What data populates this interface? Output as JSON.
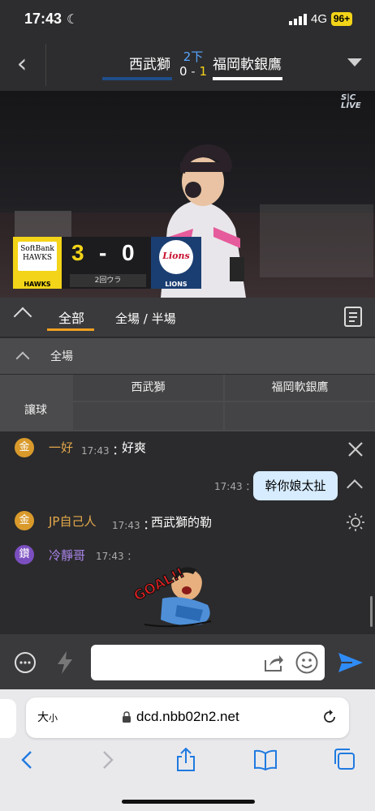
{
  "status_bar": {
    "time": "17:43",
    "network": "4G",
    "battery": "96+"
  },
  "header": {
    "home_team": "西武獅",
    "away_team": "福岡軟銀鷹",
    "inning": "2下",
    "score_home": "0",
    "score_sep": " - ",
    "score_away": "1",
    "home_color": "#1f4e8a",
    "away_color": "#ffffff",
    "inning_color": "#58a6ff"
  },
  "video": {
    "broadcast_logo": "LIVE",
    "scoreboard": {
      "home_logo_text": "SoftBank HAWKS",
      "home_name": "HAWKS",
      "home_score": "3",
      "dash": "-",
      "away_score": "0",
      "away_logo_text": "Lions",
      "away_name": "LIONS",
      "inning_status": "2回ウラ",
      "hawks_color": "#f3d418",
      "lions_color": "#1b3e72"
    }
  },
  "tabs": {
    "items": [
      {
        "label": "全部",
        "active": true
      },
      {
        "label": "全場 / 半場",
        "active": false
      }
    ],
    "accent": "#f0a020"
  },
  "odds": {
    "section_label": "全場",
    "columns": [
      "西武獅",
      "福岡軟銀鷹"
    ],
    "row_label": "讓球"
  },
  "chat": {
    "messages": [
      {
        "badge": "金",
        "user": "一好",
        "time": "17:43",
        "sep": "：",
        "text": "好爽"
      },
      {
        "time": "17:43",
        "sep": "：",
        "text": "幹你娘太扯",
        "self": true
      },
      {
        "badge": "金",
        "user": "JP自己人",
        "time": "17:43",
        "sep": "：",
        "text": "西武獅的勒"
      },
      {
        "badge": "鑽",
        "user": "冷靜哥",
        "time": "17:43",
        "sep": "：",
        "sticker": "GOAL!!"
      }
    ]
  },
  "input": {
    "placeholder": ""
  },
  "browser": {
    "text_size_big": "大",
    "text_size_small": "小",
    "url": "dcd.nbb02n2.net"
  }
}
